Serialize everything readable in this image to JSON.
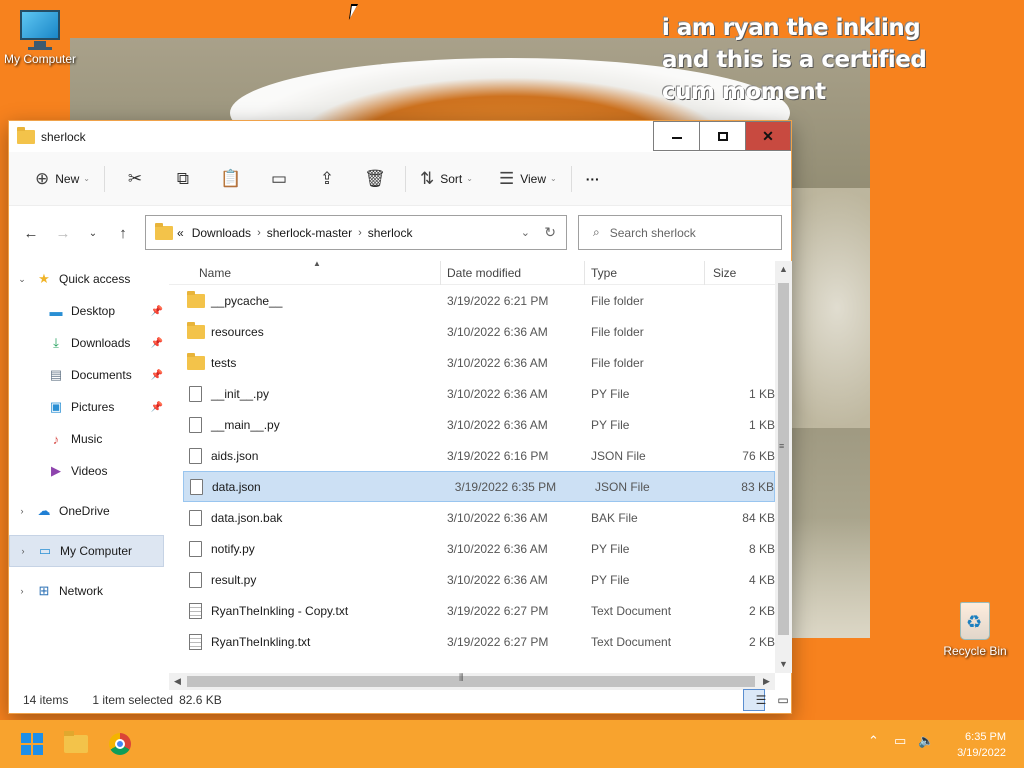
{
  "desktop": {
    "meme_text": "i am ryan the inkling and this is a certified cum moment",
    "icons": {
      "my_computer": "My Computer",
      "recycle_bin": "Recycle Bin"
    }
  },
  "window": {
    "title": "sherlock",
    "controls": {
      "minimize": "minimize",
      "maximize": "maximize",
      "close": "✕"
    }
  },
  "commandbar": {
    "new_label": "New",
    "sort_label": "Sort",
    "view_label": "View",
    "more_label": "···"
  },
  "address": {
    "overflow": "«",
    "crumbs": [
      "Downloads",
      "sherlock-master",
      "sherlock"
    ]
  },
  "search": {
    "placeholder": "Search sherlock"
  },
  "navpane": {
    "quick_access": "Quick access",
    "desktop": "Desktop",
    "downloads": "Downloads",
    "documents": "Documents",
    "pictures": "Pictures",
    "music": "Music",
    "videos": "Videos",
    "onedrive": "OneDrive",
    "my_computer": "My Computer",
    "network": "Network"
  },
  "columns": {
    "name": "Name",
    "date": "Date modified",
    "type": "Type",
    "size": "Size"
  },
  "files": [
    {
      "name": "__pycache__",
      "date": "3/19/2022 6:21 PM",
      "type": "File folder",
      "size": "",
      "kind": "folder"
    },
    {
      "name": "resources",
      "date": "3/10/2022 6:36 AM",
      "type": "File folder",
      "size": "",
      "kind": "folder"
    },
    {
      "name": "tests",
      "date": "3/10/2022 6:36 AM",
      "type": "File folder",
      "size": "",
      "kind": "folder"
    },
    {
      "name": "__init__.py",
      "date": "3/10/2022 6:36 AM",
      "type": "PY File",
      "size": "1 KB",
      "kind": "doc"
    },
    {
      "name": "__main__.py",
      "date": "3/10/2022 6:36 AM",
      "type": "PY File",
      "size": "1 KB",
      "kind": "doc"
    },
    {
      "name": "aids.json",
      "date": "3/19/2022 6:16 PM",
      "type": "JSON File",
      "size": "76 KB",
      "kind": "doc"
    },
    {
      "name": "data.json",
      "date": "3/19/2022 6:35 PM",
      "type": "JSON File",
      "size": "83 KB",
      "kind": "doc"
    },
    {
      "name": "data.json.bak",
      "date": "3/10/2022 6:36 AM",
      "type": "BAK File",
      "size": "84 KB",
      "kind": "doc"
    },
    {
      "name": "notify.py",
      "date": "3/10/2022 6:36 AM",
      "type": "PY File",
      "size": "8 KB",
      "kind": "doc"
    },
    {
      "name": "result.py",
      "date": "3/10/2022 6:36 AM",
      "type": "PY File",
      "size": "4 KB",
      "kind": "doc"
    },
    {
      "name": "RyanTheInkling - Copy.txt",
      "date": "3/19/2022 6:27 PM",
      "type": "Text Document",
      "size": "2 KB",
      "kind": "txt"
    },
    {
      "name": "RyanTheInkling.txt",
      "date": "3/19/2022 6:27 PM",
      "type": "Text Document",
      "size": "2 KB",
      "kind": "txt"
    }
  ],
  "status": {
    "item_count": "14 items",
    "selection": "1 item selected",
    "selection_size": "82.6 KB"
  },
  "taskbar": {
    "time": "6:35 PM",
    "date": "3/19/2022"
  },
  "colors": {
    "desktop_bg": "#f7821e",
    "taskbar_bg": "#f8a32e",
    "selection_bg": "#cce0f4",
    "close_button": "#c84a40"
  }
}
